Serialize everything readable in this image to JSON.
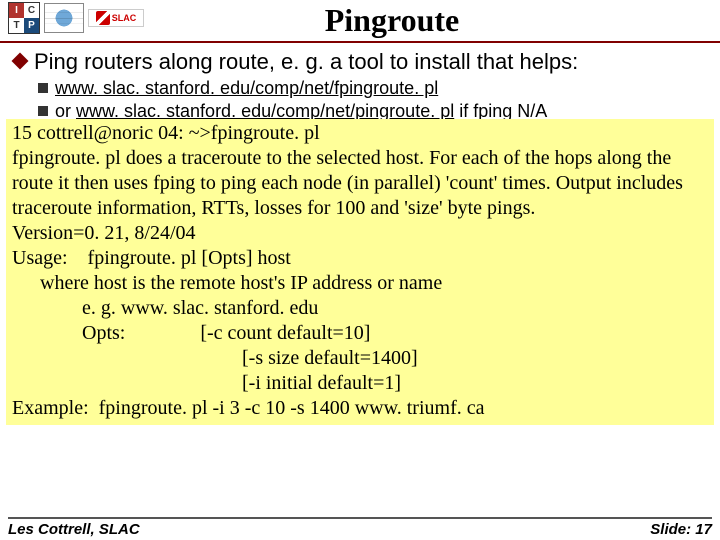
{
  "title": "Pingroute",
  "main_bullet": "Ping routers along route, e. g. a tool to install that helps:",
  "sub_bullets": [
    {
      "link": "www. slac. stanford. edu/comp/net/fpingroute. pl",
      "rest": ""
    },
    {
      "prefix": "or ",
      "link": "www. slac. stanford. edu/comp/net/pingroute. pl",
      "rest": " if fping N/A"
    }
  ],
  "terminal": {
    "lines": [
      "15 cottrell@noric 04: ~>fpingroute. pl",
      "fpingroute. pl does a traceroute to the selected host. For each of the hops along the route it then uses fping to ping each node (in parallel) 'count' times. Output includes traceroute information, RTTs, losses for 100 and 'size' byte pings.",
      "Version=0. 21, 8/24/04",
      "Usage:    fpingroute. pl [Opts] host",
      "  where host is the remote host's IP address or name",
      "      e. g. www. slac. stanford. edu",
      "      Opts:               [-c count default=10]",
      "                      [-s size default=1400]",
      "                      [-i initial default=1]",
      "Example:  fpingroute. pl -i 3 -c 10 -s 1400 www. triumf. ca"
    ]
  },
  "footer": {
    "left": "Les Cottrell, SLAC",
    "right": "Slide: 17"
  },
  "logos": {
    "slac": "SLAC"
  }
}
